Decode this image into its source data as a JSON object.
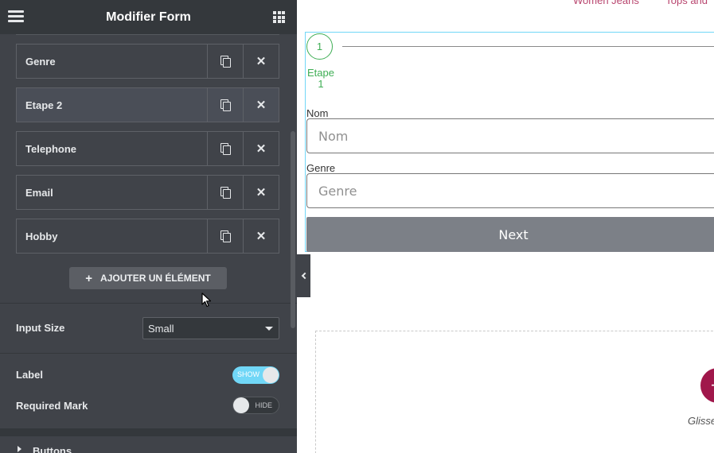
{
  "panel": {
    "title": "Modifier Form",
    "items": [
      {
        "label": "Genre",
        "active": false
      },
      {
        "label": "Etape 2",
        "active": true
      },
      {
        "label": "Telephone",
        "active": false
      },
      {
        "label": "Email",
        "active": false
      },
      {
        "label": "Hobby",
        "active": false
      }
    ],
    "add_label": "AJOUTER UN ÉLÉMENT",
    "input_size": {
      "label": "Input Size",
      "value": "Small"
    },
    "label_toggle": {
      "label": "Label",
      "state": "SHOW"
    },
    "required_toggle": {
      "label": "Required Mark",
      "state": "HIDE"
    },
    "next_section": "Buttons",
    "colors": {
      "panel_bg": "#404349",
      "header_bg": "#34383c",
      "switch_on": "#71d7f7"
    }
  },
  "preview": {
    "top_links": [
      "Women Jeans",
      "Tops and"
    ],
    "step": {
      "number": "1",
      "label": "Etape 1"
    },
    "fields": [
      {
        "label": "Nom",
        "placeholder": "Nom"
      },
      {
        "label": "Genre",
        "placeholder": "Genre"
      }
    ],
    "next_label": "Next",
    "drop_hint": "Glisse",
    "colors": {
      "step": "#3fae55",
      "selected_border": "#71d7f7",
      "next_button": "#7c8087",
      "add_circle": "#a0174b"
    }
  }
}
